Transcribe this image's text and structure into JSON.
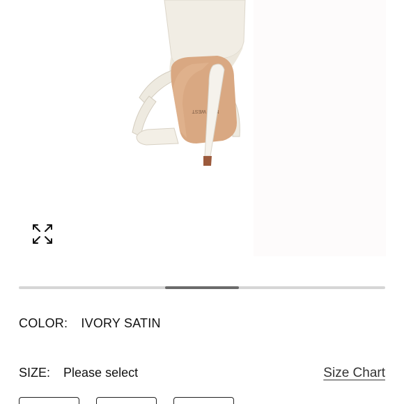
{
  "product": {
    "image_alt": "Ivory satin high-heel strappy sandal, back view",
    "sole_brand_text": "NINE WEST",
    "expand_icon": "expand-arrows-icon"
  },
  "carousel": {
    "current_index": 3,
    "total": 5
  },
  "color": {
    "label": "COLOR:",
    "value": "IVORY SATIN"
  },
  "size": {
    "label": "SIZE:",
    "value": "Please select",
    "size_chart_label": "Size Chart",
    "options_visible": 3
  },
  "colors": {
    "shoe": "#f1ede4",
    "sole": "#d9a882",
    "heel_tip": "#9c5a3c",
    "track": "#d6d6d6",
    "thumb": "#6b6b6b"
  }
}
